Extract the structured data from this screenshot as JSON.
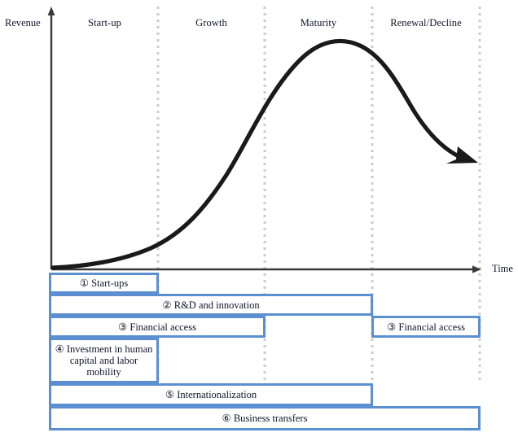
{
  "axes": {
    "y_label": "Revenue",
    "x_label": "Time"
  },
  "stages": [
    {
      "label": "Start-up"
    },
    {
      "label": "Growth"
    },
    {
      "label": "Maturity"
    },
    {
      "label": "Renewal/Decline"
    }
  ],
  "measures": [
    {
      "label": "①  Start-ups"
    },
    {
      "label": "② R&D and innovation"
    },
    {
      "label": "③ Financial access"
    },
    {
      "label": "③  Financial access"
    },
    {
      "label": "④ Investment in human capital and labor mobility"
    },
    {
      "label": "⑤ Internationalization"
    },
    {
      "label": "⑥ Business transfers"
    }
  ],
  "colors": {
    "box_border": "#5b8fd0",
    "curve": "#1a1a1a",
    "axis": "#3a3a3a",
    "divider": "#cccccc",
    "text": "#13132b"
  },
  "chart_data": {
    "type": "line",
    "title": "",
    "xlabel": "Time",
    "ylabel": "Revenue",
    "categories": [
      "Start-up",
      "Growth",
      "Maturity",
      "Renewal/Decline"
    ],
    "grid": false,
    "legend": "none",
    "annotations": [
      "①  Start-ups",
      "② R&D and innovation",
      "③ Financial access",
      "④ Investment in human capital and labor mobility",
      "⑤ Internationalization",
      "⑥ Business transfers"
    ],
    "series": [
      {
        "name": "Revenue",
        "x": [
          0,
          10,
          20,
          25,
          35,
          45,
          55,
          62,
          70,
          78,
          85,
          92,
          100
        ],
        "y": [
          1,
          3,
          8,
          12,
          26,
          48,
          70,
          84,
          92,
          94,
          86,
          66,
          45
        ]
      }
    ]
  }
}
